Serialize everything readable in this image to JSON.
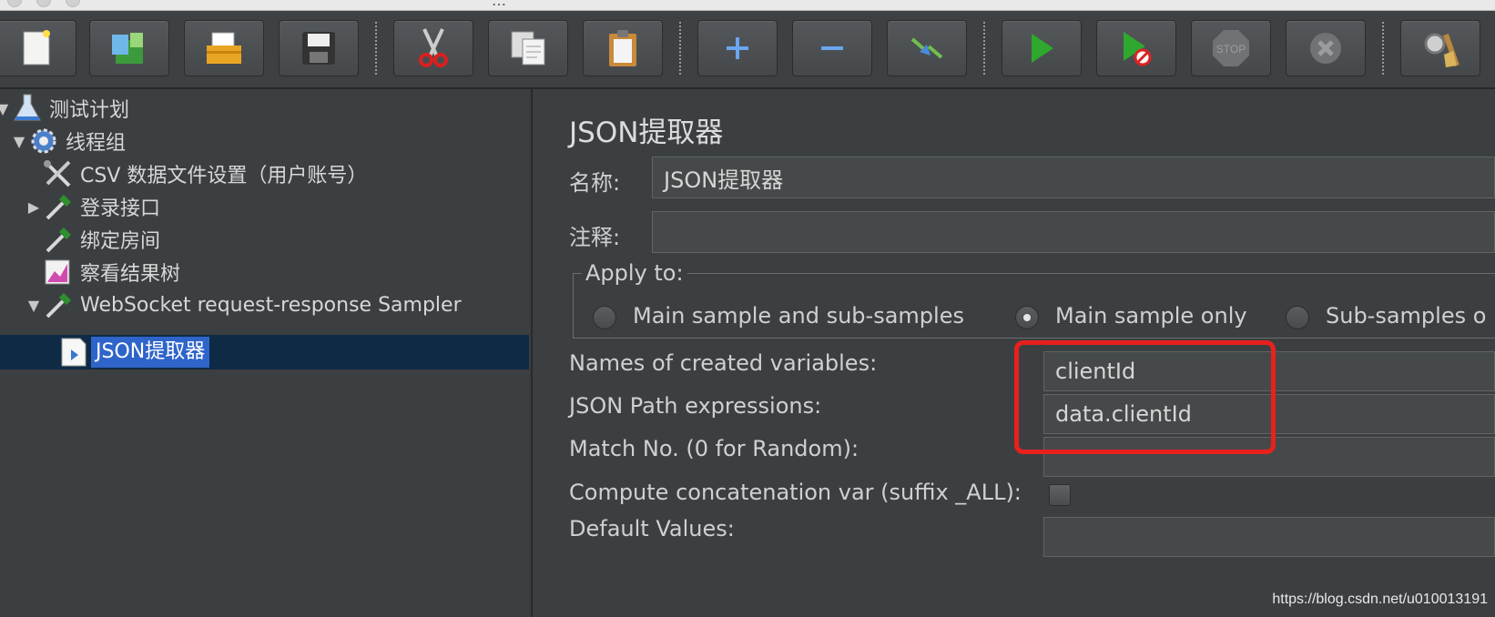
{
  "window": {
    "title": "…"
  },
  "toolbar": {
    "buttons": [
      {
        "name": "new-icon"
      },
      {
        "name": "templates-icon"
      },
      {
        "name": "open-icon"
      },
      {
        "name": "save-icon"
      },
      {
        "name": "cut-icon"
      },
      {
        "name": "copy-icon"
      },
      {
        "name": "paste-icon"
      },
      {
        "name": "expand-icon"
      },
      {
        "name": "collapse-icon"
      },
      {
        "name": "toggle-icon"
      },
      {
        "name": "start-icon"
      },
      {
        "name": "start-no-pause-icon"
      },
      {
        "name": "stop-icon"
      },
      {
        "name": "shutdown-icon"
      },
      {
        "name": "clear-icon"
      }
    ]
  },
  "tree": {
    "items": [
      {
        "label": "测试计划",
        "icon": "flask-icon"
      },
      {
        "label": "线程组",
        "icon": "gear-icon"
      },
      {
        "label": "CSV 数据文件设置（用户账号）",
        "icon": "tools-icon"
      },
      {
        "label": "登录接口",
        "icon": "pipette-icon"
      },
      {
        "label": "绑定房间",
        "icon": "pipette-icon"
      },
      {
        "label": "察看结果树",
        "icon": "graph-icon"
      },
      {
        "label": "WebSocket request-response Sampler",
        "icon": "pipette-icon"
      },
      {
        "label": "JSON提取器",
        "icon": "document-icon",
        "selected": true
      }
    ]
  },
  "panel": {
    "title": "JSON提取器",
    "name_label": "名称:",
    "name_value": "JSON提取器",
    "comment_label": "注释:",
    "comment_value": "",
    "apply_to": {
      "legend": "Apply to:",
      "options": [
        "Main sample and sub-samples",
        "Main sample only",
        "Sub-samples o"
      ],
      "selected": "Main sample only"
    },
    "variables_label": "Names of created variables:",
    "variables_value": "clientId",
    "json_path_label": "JSON Path expressions:",
    "json_path_value": "data.clientId",
    "match_no_label": "Match No. (0 for Random):",
    "match_no_value": "",
    "concat_label": "Compute concatenation var (suffix _ALL):",
    "concat_checked": false,
    "default_label": "Default Values:",
    "default_value": ""
  },
  "highlight_color": "#e8211d",
  "watermark": "https://blog.csdn.net/u010013191"
}
